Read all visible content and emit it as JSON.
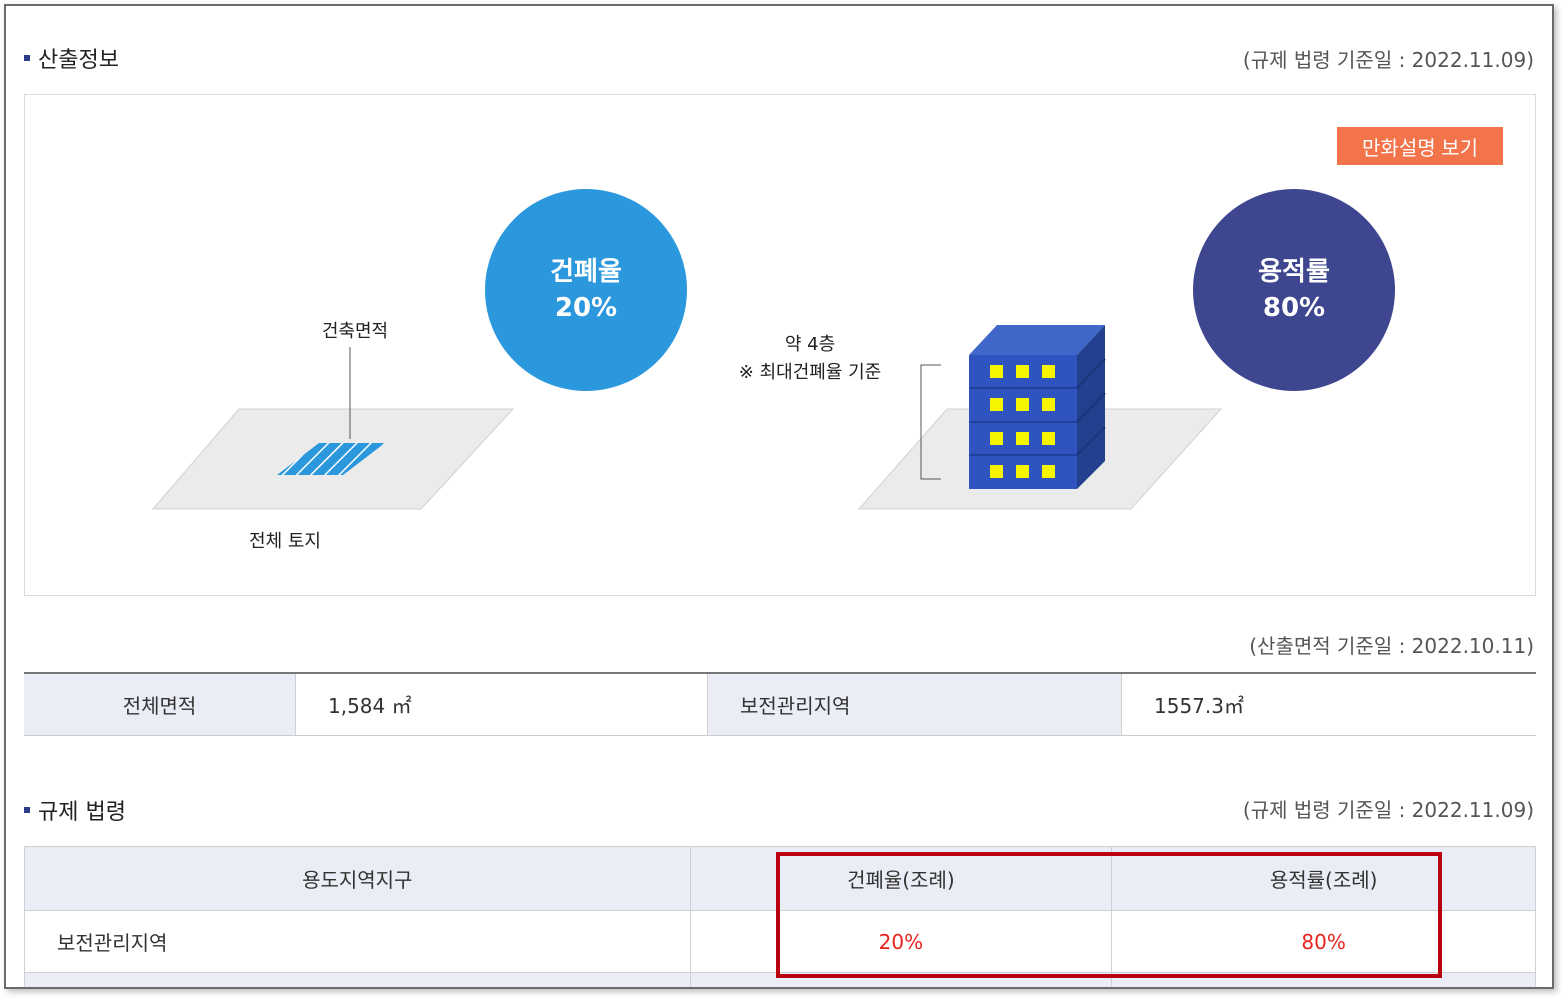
{
  "calc_section": {
    "title": "산출정보",
    "basis": "(규제 법령 기준일 : 2022.11.09)"
  },
  "diagram": {
    "comic_button": "만화설명 보기",
    "bcr": {
      "label": "건폐율",
      "value": "20%"
    },
    "far": {
      "label": "용적률",
      "value": "80%"
    },
    "building_area_label": "건축면적",
    "total_land_label": "전체 토지",
    "floors_text": "약 4층",
    "floors_note": "※ 최대건폐율 기준"
  },
  "area_basis": "(산출면적 기준일 : 2022.10.11)",
  "area_table": {
    "total_area_header": "전체면적",
    "total_area_value": "1,584 ㎡",
    "zone_header": "보전관리지역",
    "zone_value": "1557.3㎡"
  },
  "law_section": {
    "title": "규제 법령",
    "basis": "(규제 법령 기준일 : 2022.11.09)",
    "headers": [
      "용도지역지구",
      "건폐율(조례)",
      "용적률(조례)"
    ],
    "row": {
      "zone": "보전관리지역",
      "bcr": "20%",
      "far": "80%"
    }
  },
  "colors": {
    "bcr_circle": "#2b97dc",
    "far_circle": "#3d468f",
    "comic_button": "#f3744a",
    "highlight_border": "#b80011",
    "value_red": "#e8231c"
  }
}
